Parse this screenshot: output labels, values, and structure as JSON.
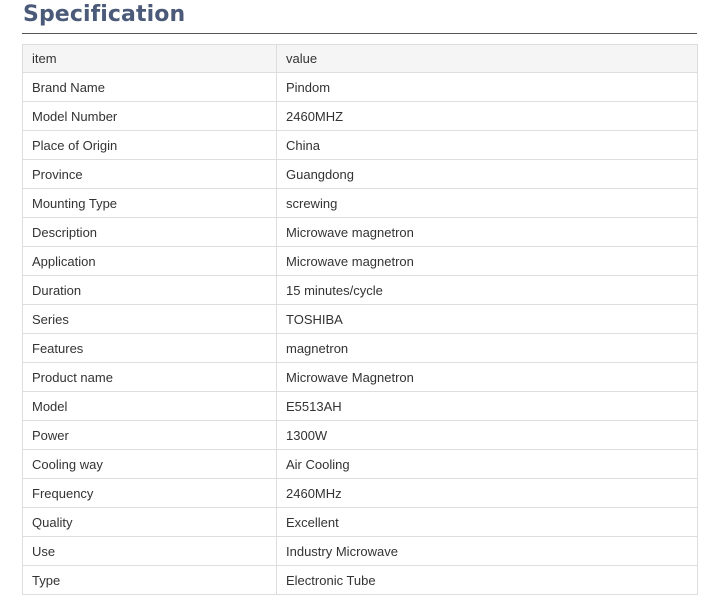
{
  "section": {
    "title": "Specification"
  },
  "table": {
    "header": {
      "item": "item",
      "value": "value"
    },
    "rows": [
      {
        "item": "Brand Name",
        "value": "Pindom"
      },
      {
        "item": "Model Number",
        "value": "2460MHZ"
      },
      {
        "item": "Place of Origin",
        "value": "China"
      },
      {
        "item": "Province",
        "value": "Guangdong"
      },
      {
        "item": "Mounting Type",
        "value": "screwing"
      },
      {
        "item": "Description",
        "value": "Microwave magnetron"
      },
      {
        "item": "Application",
        "value": "Microwave magnetron"
      },
      {
        "item": "Duration",
        "value": "15 minutes/cycle"
      },
      {
        "item": "Series",
        "value": "TOSHIBA"
      },
      {
        "item": "Features",
        "value": "magnetron"
      },
      {
        "item": "Product name",
        "value": "Microwave Magnetron"
      },
      {
        "item": "Model",
        "value": "E5513AH"
      },
      {
        "item": "Power",
        "value": "1300W"
      },
      {
        "item": "Cooling way",
        "value": "Air Cooling"
      },
      {
        "item": "Frequency",
        "value": "2460MHz"
      },
      {
        "item": "Quality",
        "value": "Excellent"
      },
      {
        "item": "Use",
        "value": "Industry Microwave"
      },
      {
        "item": "Type",
        "value": "Electronic Tube"
      }
    ]
  }
}
